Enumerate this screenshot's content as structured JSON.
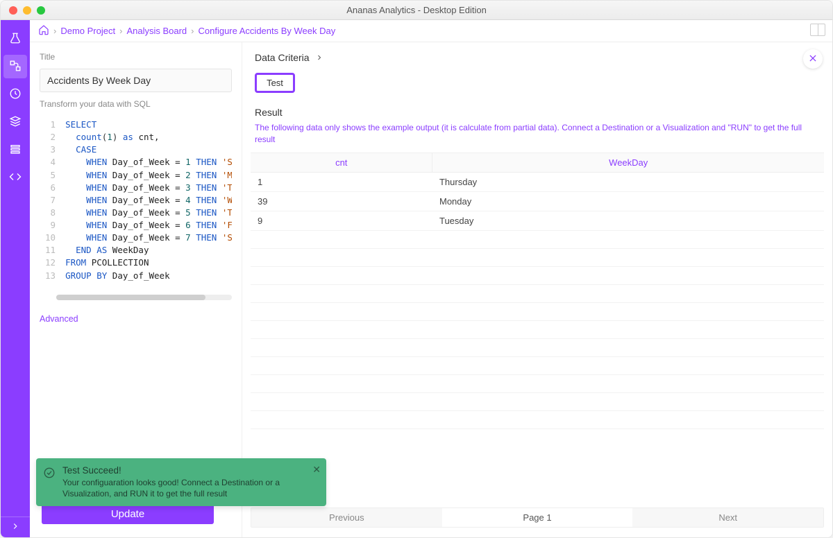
{
  "window": {
    "title": "Ananas Analytics - Desktop Edition"
  },
  "breadcrumb": {
    "items": [
      "Demo Project",
      "Analysis Board",
      "Configure Accidents By Week Day"
    ]
  },
  "leftPane": {
    "titleLabel": "Title",
    "titleValue": "Accidents By Week Day",
    "sqlLabel": "Transform your data with SQL",
    "advanced": "Advanced",
    "updateBtn": "Update",
    "code": {
      "lines": [
        {
          "n": 1,
          "tokens": [
            [
              "kw",
              "SELECT"
            ]
          ]
        },
        {
          "n": 2,
          "tokens": [
            [
              "",
              "  "
            ],
            [
              "fn",
              "count"
            ],
            [
              "",
              "("
            ],
            [
              "num",
              "1"
            ],
            [
              "",
              ") "
            ],
            [
              "kw",
              "as"
            ],
            [
              "",
              ""
            ],
            [
              "",
              ""
            ],
            [
              "",
              ""
            ],
            [
              "",
              ""
            ],
            [
              "",
              ""
            ],
            [
              "",
              ""
            ],
            [
              "",
              ""
            ],
            [
              "",
              ""
            ],
            [
              "",
              ""
            ],
            [
              "",
              ""
            ],
            [
              "",
              ""
            ],
            [
              "",
              ""
            ],
            [
              "",
              ""
            ],
            [
              "",
              ""
            ],
            [
              "",
              ""
            ],
            [
              "",
              ""
            ],
            [
              "",
              ""
            ],
            [
              "",
              ""
            ],
            [
              "",
              ""
            ],
            [
              "",
              ""
            ],
            [
              "",
              ""
            ],
            [
              "",
              ""
            ],
            [
              "",
              ""
            ],
            [
              "",
              ""
            ],
            [
              "",
              ""
            ],
            [
              "",
              ""
            ],
            [
              "",
              ""
            ],
            [
              "",
              ""
            ],
            [
              "",
              ""
            ],
            [
              "",
              ""
            ],
            [
              "",
              ""
            ],
            [
              "",
              ""
            ]
          ],
          "raw_after_as": " cnt,"
        },
        {
          "n": 3,
          "tokens": [
            [
              "",
              "  "
            ],
            [
              "kw",
              "CASE"
            ]
          ]
        },
        {
          "n": 4,
          "tokens": [
            [
              "",
              "    "
            ],
            [
              "kw",
              "WHEN"
            ],
            [
              "",
              ""
            ],
            [
              "ident",
              " Day_of_Week = "
            ],
            [
              "num",
              "1"
            ],
            [
              "",
              ""
            ],
            [
              "kw",
              " THEN "
            ],
            [
              "str",
              "'Sunday"
            ]
          ]
        },
        {
          "n": 5,
          "tokens": [
            [
              "",
              "    "
            ],
            [
              "kw",
              "WHEN"
            ],
            [
              "ident",
              " Day_of_Week = "
            ],
            [
              "num",
              "2"
            ],
            [
              "kw",
              " THEN "
            ],
            [
              "str",
              "'Monday"
            ]
          ]
        },
        {
          "n": 6,
          "tokens": [
            [
              "",
              "    "
            ],
            [
              "kw",
              "WHEN"
            ],
            [
              "ident",
              " Day_of_Week = "
            ],
            [
              "num",
              "3"
            ],
            [
              "kw",
              " THEN "
            ],
            [
              "str",
              "'Tuesda"
            ]
          ]
        },
        {
          "n": 7,
          "tokens": [
            [
              "",
              "    "
            ],
            [
              "kw",
              "WHEN"
            ],
            [
              "ident",
              " Day_of_Week = "
            ],
            [
              "num",
              "4"
            ],
            [
              "kw",
              " THEN "
            ],
            [
              "str",
              "'Wednes"
            ]
          ]
        },
        {
          "n": 8,
          "tokens": [
            [
              "",
              "    "
            ],
            [
              "kw",
              "WHEN"
            ],
            [
              "ident",
              " Day_of_Week = "
            ],
            [
              "num",
              "5"
            ],
            [
              "kw",
              " THEN "
            ],
            [
              "str",
              "'Thursd"
            ]
          ]
        },
        {
          "n": 9,
          "tokens": [
            [
              "",
              "    "
            ],
            [
              "kw",
              "WHEN"
            ],
            [
              "ident",
              " Day_of_Week = "
            ],
            [
              "num",
              "6"
            ],
            [
              "kw",
              " THEN "
            ],
            [
              "str",
              "'Friday"
            ]
          ]
        },
        {
          "n": 10,
          "tokens": [
            [
              "",
              "    "
            ],
            [
              "kw",
              "WHEN"
            ],
            [
              "ident",
              " Day_of_Week = "
            ],
            [
              "num",
              "7"
            ],
            [
              "kw",
              " THEN "
            ],
            [
              "str",
              "'Saturd"
            ]
          ]
        },
        {
          "n": 11,
          "tokens": [
            [
              "",
              "  "
            ],
            [
              "kw",
              "END AS"
            ],
            [
              "ident",
              " WeekDay"
            ]
          ]
        },
        {
          "n": 12,
          "tokens": [
            [
              "kw",
              "FROM"
            ],
            [
              "ident",
              " PCOLLECTION"
            ]
          ]
        },
        {
          "n": 13,
          "tokens": [
            [
              "kw",
              "GROUP BY"
            ],
            [
              "ident",
              " Day_of_Week"
            ]
          ]
        }
      ]
    }
  },
  "rightPane": {
    "dataCriteria": "Data Criteria",
    "testBtn": "Test",
    "resultHead": "Result",
    "resultNote": "The following data only shows the example output (it is calculate from partial data). Connect a Destination or a Visualization and \"RUN\" to get the full result",
    "columns": [
      "cnt",
      "WeekDay"
    ],
    "rows": [
      {
        "cnt": "1",
        "WeekDay": "Thursday"
      },
      {
        "cnt": "39",
        "WeekDay": "Monday"
      },
      {
        "cnt": "9",
        "WeekDay": "Tuesday"
      }
    ],
    "pager": {
      "prev": "Previous",
      "page": "Page 1",
      "next": "Next"
    }
  },
  "toast": {
    "title": "Test Succeed!",
    "desc": "Your configuaration looks good! Connect a Destination or a Visualization, and RUN it to get the full result"
  },
  "colors": {
    "accent": "#8b3dff",
    "success": "#4bb280"
  }
}
